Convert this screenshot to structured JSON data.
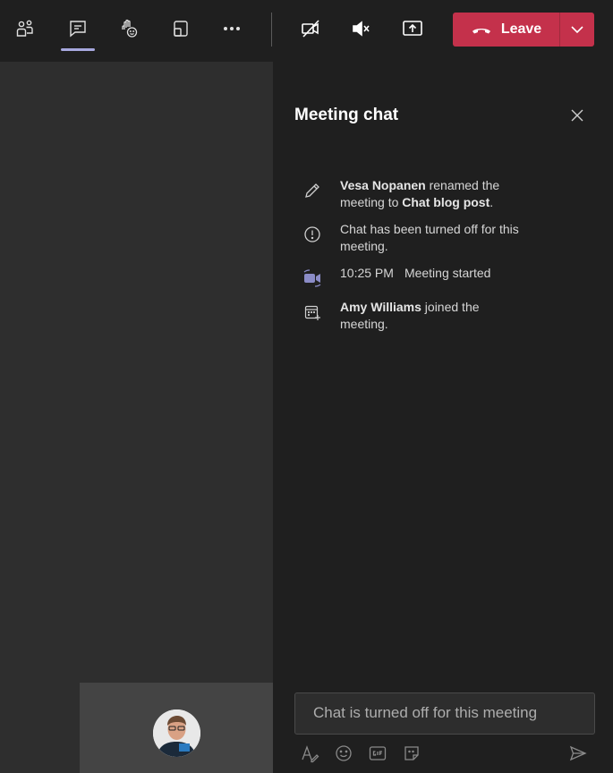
{
  "toolbar": {
    "buttons": [
      {
        "icon": "people-icon"
      },
      {
        "icon": "chat-icon",
        "active": true
      },
      {
        "icon": "raise-hand-icon"
      },
      {
        "icon": "breakout-rooms-icon"
      },
      {
        "icon": "more-icon"
      },
      {
        "icon": "camera-off-icon"
      },
      {
        "icon": "mic-muted-icon"
      },
      {
        "icon": "share-screen-icon"
      }
    ],
    "leave_label": "Leave"
  },
  "chat_panel": {
    "title": "Meeting chat",
    "events": [
      {
        "icon": "pencil-icon",
        "bold1": "Vesa Nopanen",
        "text1": " renamed the meeting to ",
        "bold2": "Chat blog post",
        "text2": "."
      },
      {
        "icon": "info-icon",
        "text": "Chat has been turned off for this meeting."
      },
      {
        "icon": "video-camera-icon",
        "time": "10:25 PM",
        "text": "Meeting started"
      },
      {
        "icon": "calendar-add-icon",
        "bold1": "Amy Williams",
        "text1": " joined the meeting."
      }
    ],
    "composer_placeholder": "Chat is turned off for this meeting"
  },
  "colors": {
    "leave_red": "#c4314b",
    "accent": "#a7a8de",
    "panel_bg": "#1f1f1f",
    "stage_bg": "#2e2e2e"
  }
}
